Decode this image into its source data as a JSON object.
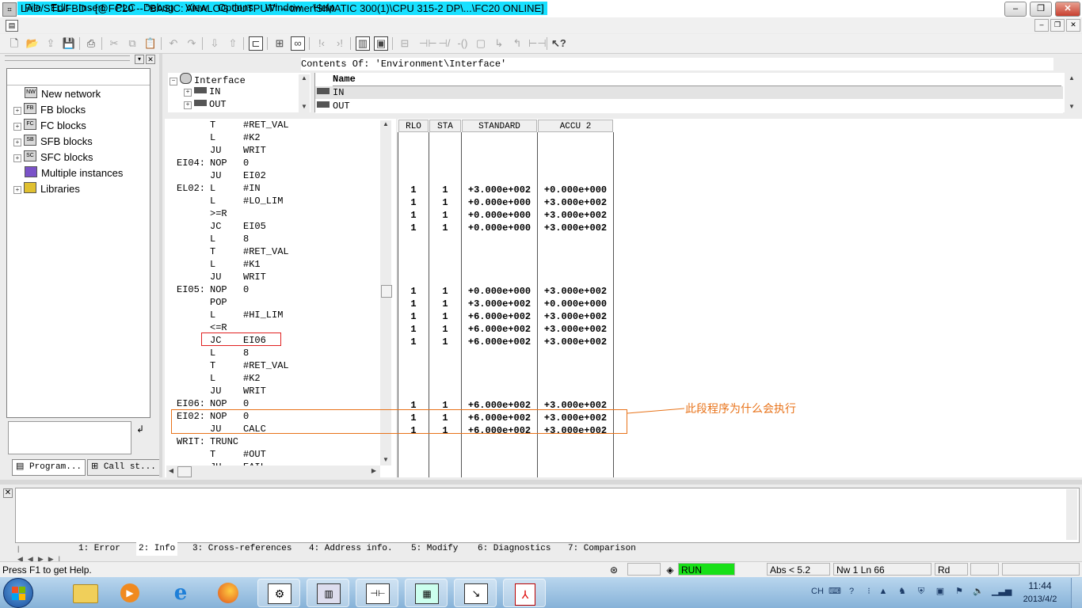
{
  "title": "LAD/STL/FBD  - [@FC20 -- \"BASIC: ANALOG OUTPUT\" -- timer\\SIMATIC 300(1)\\CPU 315-2 DP\\...\\FC20  ONLINE]",
  "menu": [
    "File",
    "Edit",
    "Insert",
    "PLC",
    "Debug",
    "View",
    "Options",
    "Window",
    "Help"
  ],
  "left_tree": [
    {
      "label": "New network",
      "icon": "new-network-icon",
      "expandable": false
    },
    {
      "label": "FB blocks",
      "icon": "fb-block-icon",
      "expandable": true
    },
    {
      "label": "FC blocks",
      "icon": "fc-block-icon",
      "expandable": true
    },
    {
      "label": "SFB blocks",
      "icon": "sfb-block-icon",
      "expandable": true
    },
    {
      "label": "SFC blocks",
      "icon": "sfc-block-icon",
      "expandable": true
    },
    {
      "label": "Multiple instances",
      "icon": "instances-icon",
      "expandable": false
    },
    {
      "label": "Libraries",
      "icon": "libraries-icon",
      "expandable": true
    }
  ],
  "left_tabs": [
    "Program...",
    "Call st..."
  ],
  "interface": {
    "header": "Contents Of: 'Environment\\Interface'",
    "root": "Interface",
    "children": [
      "IN",
      "OUT"
    ],
    "list_header": "Name",
    "list_items": [
      "IN",
      "OUT"
    ]
  },
  "code_lines": [
    {
      "label": "",
      "op": "T",
      "arg": "#RET_VAL"
    },
    {
      "label": "",
      "op": "L",
      "arg": "#K2"
    },
    {
      "label": "",
      "op": "JU",
      "arg": "WRIT"
    },
    {
      "label": "EI04:",
      "op": "NOP",
      "arg": "0"
    },
    {
      "label": "",
      "op": "JU",
      "arg": "EI02"
    },
    {
      "label": "EL02:",
      "op": "L",
      "arg": "#IN"
    },
    {
      "label": "",
      "op": "L",
      "arg": "#LO_LIM"
    },
    {
      "label": "",
      "op": ">=R",
      "arg": ""
    },
    {
      "label": "",
      "op": "JC",
      "arg": "EI05"
    },
    {
      "label": "",
      "op": "L",
      "arg": "8"
    },
    {
      "label": "",
      "op": "T",
      "arg": "#RET_VAL"
    },
    {
      "label": "",
      "op": "L",
      "arg": "#K1"
    },
    {
      "label": "",
      "op": "JU",
      "arg": "WRIT"
    },
    {
      "label": "EI05:",
      "op": "NOP",
      "arg": "0"
    },
    {
      "label": "",
      "op": "POP",
      "arg": ""
    },
    {
      "label": "",
      "op": "L",
      "arg": "#HI_LIM"
    },
    {
      "label": "",
      "op": "<=R",
      "arg": ""
    },
    {
      "label": "",
      "op": "JC",
      "arg": "EI06"
    },
    {
      "label": "",
      "op": "L",
      "arg": "8"
    },
    {
      "label": "",
      "op": "T",
      "arg": "#RET_VAL"
    },
    {
      "label": "",
      "op": "L",
      "arg": "#K2"
    },
    {
      "label": "",
      "op": "JU",
      "arg": "WRIT"
    },
    {
      "label": "EI06:",
      "op": "NOP",
      "arg": "0"
    },
    {
      "label": "EI02:",
      "op": "NOP",
      "arg": "0"
    },
    {
      "label": "",
      "op": "JU",
      "arg": "CALC"
    },
    {
      "label": "WRIT:",
      "op": "TRUNC",
      "arg": ""
    },
    {
      "label": "",
      "op": "T",
      "arg": "#OUT"
    },
    {
      "label": "",
      "op": "JU",
      "arg": "EAIL"
    }
  ],
  "status_columns": [
    "RLO",
    "STA",
    "STANDARD",
    "ACCU 2"
  ],
  "status_rows": [
    {
      "line": 5,
      "rlo": "1",
      "sta": "1",
      "standard": "+3.000e+002",
      "accu2": "+0.000e+000"
    },
    {
      "line": 6,
      "rlo": "1",
      "sta": "1",
      "standard": "+0.000e+000",
      "accu2": "+3.000e+002"
    },
    {
      "line": 7,
      "rlo": "1",
      "sta": "1",
      "standard": "+0.000e+000",
      "accu2": "+3.000e+002"
    },
    {
      "line": 8,
      "rlo": "1",
      "sta": "1",
      "standard": "+0.000e+000",
      "accu2": "+3.000e+002"
    },
    {
      "line": 13,
      "rlo": "1",
      "sta": "1",
      "standard": "+0.000e+000",
      "accu2": "+3.000e+002"
    },
    {
      "line": 14,
      "rlo": "1",
      "sta": "1",
      "standard": "+3.000e+002",
      "accu2": "+0.000e+000"
    },
    {
      "line": 15,
      "rlo": "1",
      "sta": "1",
      "standard": "+6.000e+002",
      "accu2": "+3.000e+002"
    },
    {
      "line": 16,
      "rlo": "1",
      "sta": "1",
      "standard": "+6.000e+002",
      "accu2": "+3.000e+002"
    },
    {
      "line": 17,
      "rlo": "1",
      "sta": "1",
      "standard": "+6.000e+002",
      "accu2": "+3.000e+002"
    },
    {
      "line": 22,
      "rlo": "1",
      "sta": "1",
      "standard": "+6.000e+002",
      "accu2": "+3.000e+002"
    },
    {
      "line": 23,
      "rlo": "1",
      "sta": "1",
      "standard": "+6.000e+002",
      "accu2": "+3.000e+002"
    },
    {
      "line": 24,
      "rlo": "1",
      "sta": "1",
      "standard": "+6.000e+002",
      "accu2": "+3.000e+002"
    }
  ],
  "annotation": "此段程序为什么会执行",
  "annotation_color": "#e8731a",
  "highlight_color": "#e02020",
  "output_tabs": [
    "1: Error",
    "2: Info",
    "3: Cross-references",
    "4: Address info.",
    "5: Modify",
    "6: Diagnostics",
    "7: Comparison"
  ],
  "status": {
    "help": "Press F1 to get Help.",
    "mode": "RUN",
    "mode_color": "#17e017",
    "abs": "Abs < 5.2",
    "position": "Nw 1  Ln 66",
    "rd": "Rd"
  },
  "taskbar": {
    "apps": [
      "file-explorer-icon",
      "media-player-icon",
      "internet-explorer-icon",
      "firefox-icon",
      "simatic-manager-icon",
      "hardware-config-icon",
      "lad-stl-fbd-icon",
      "s7-plcsim-icon",
      "netpro-icon",
      "pdf-reader-icon"
    ],
    "lang": "CH",
    "time": "11:44",
    "date": "2013/4/2"
  }
}
